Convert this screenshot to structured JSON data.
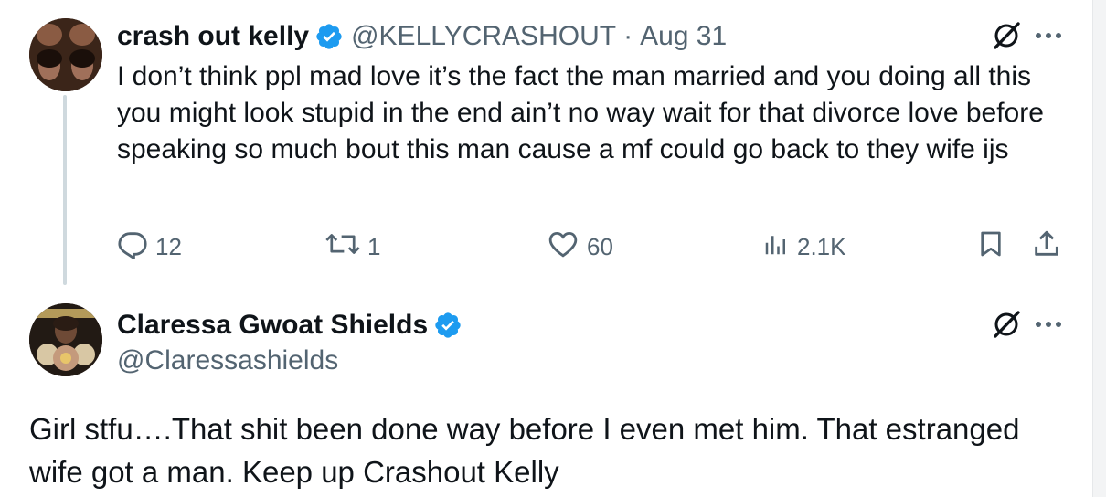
{
  "tweet1": {
    "display_name": "crash out kelly",
    "handle": "@KELLYCRASHOUT",
    "separator": "·",
    "date": "Aug 31",
    "text": "I don’t think ppl mad love it’s the fact the man married and you doing all this you might look stupid in the end ain’t no way wait for that divorce love before speaking so much bout this man cause a mf could go back to they wife ijs",
    "replies": "12",
    "retweets": "1",
    "likes": "60",
    "views": "2.1K"
  },
  "tweet2": {
    "display_name": "Claressa Gwoat Shields",
    "handle": "@Claressashields",
    "text": "Girl stfu….That shit been done way before I even met him. That estranged wife got a man. Keep up Crashout Kelly"
  },
  "colors": {
    "text": "#0f1419",
    "secondary": "#536471",
    "verified": "#1d9bf0",
    "thread_line": "#cfd9de"
  },
  "icons": [
    "grok-icon",
    "more-icon",
    "reply-icon",
    "retweet-icon",
    "like-icon",
    "views-icon",
    "bookmark-icon",
    "share-icon",
    "verified-badge-icon"
  ]
}
